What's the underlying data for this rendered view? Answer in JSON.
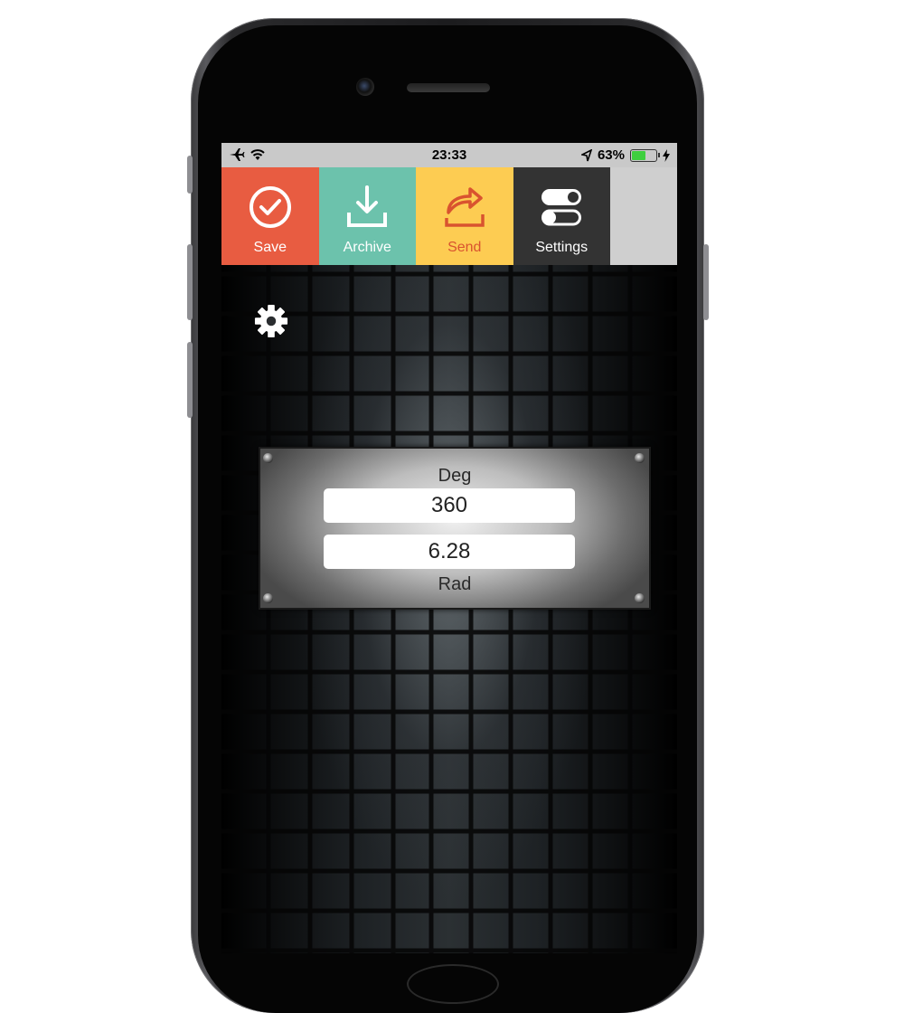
{
  "status_bar": {
    "time": "23:33",
    "battery_text": "63%",
    "battery_level": 0.63,
    "icons": [
      "airplane-icon",
      "wifi-icon",
      "location-arrow-icon",
      "battery-icon",
      "charging-bolt-icon"
    ]
  },
  "toolbar": {
    "items": [
      {
        "label": "Save",
        "icon": "check-circle-icon",
        "color": "#e85c41"
      },
      {
        "label": "Archive",
        "icon": "download-tray-icon",
        "color": "#6cc2ac"
      },
      {
        "label": "Send",
        "icon": "share-arrow-icon",
        "color": "#fdcc52"
      },
      {
        "label": "Settings",
        "icon": "toggles-icon",
        "color": "#333333"
      }
    ]
  },
  "converter": {
    "deg_label": "Deg",
    "deg_value": "360",
    "rad_value": "6.28",
    "rad_label": "Rad"
  }
}
